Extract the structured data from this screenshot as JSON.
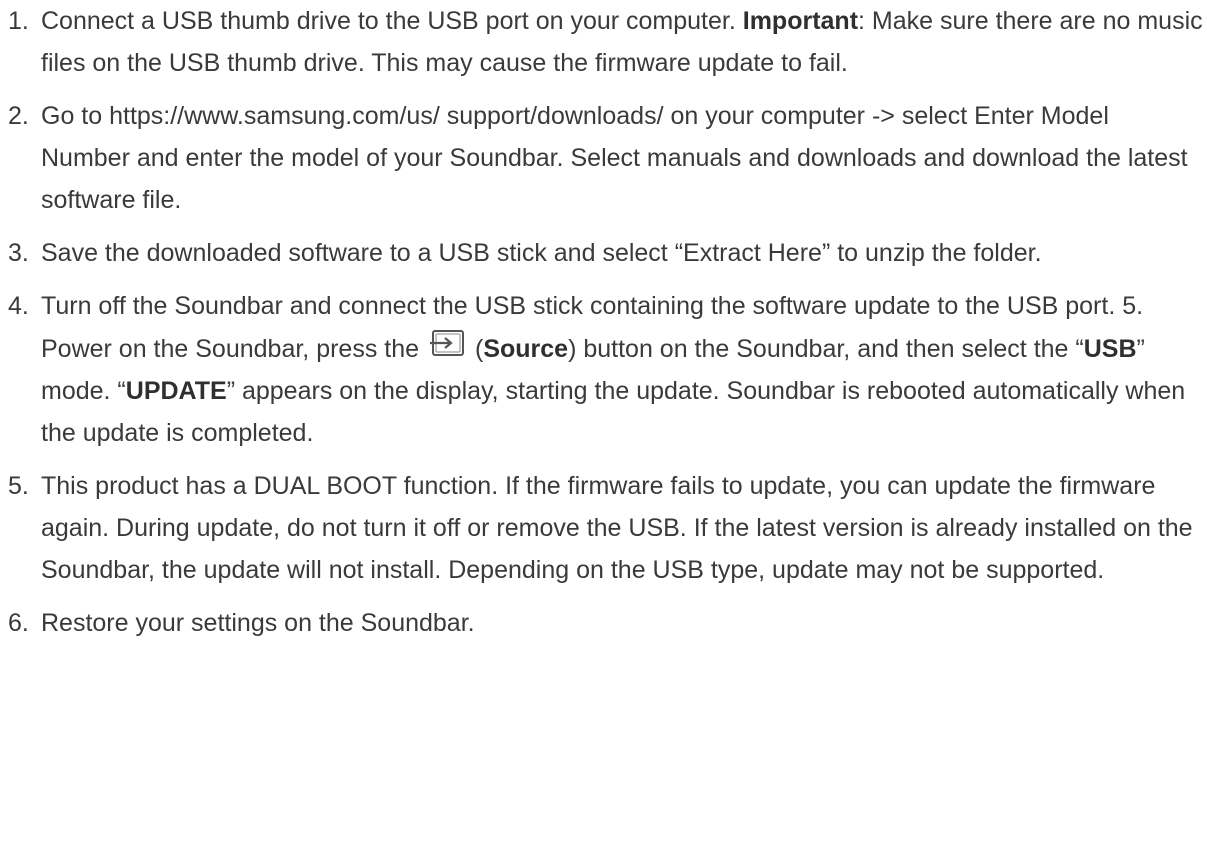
{
  "steps": [
    {
      "num": "1.",
      "t1": "Connect a USB thumb drive to the USB port on your computer. ",
      "b1": "Important",
      "t2": ": Make sure there are no music files on the USB thumb drive. This may cause the firmware update to fail."
    },
    {
      "num": "2.",
      "t1": "Go to https://www.samsung.com/us/ support/downloads/ on your computer -> select Enter Model Number and enter the model of your Soundbar. Select manuals and downloads and download the latest software file."
    },
    {
      "num": "3.",
      "t1": "Save the downloaded software to a USB stick and select “Extract Here” to unzip the folder."
    },
    {
      "num": "4.",
      "t1": "Turn off the Soundbar and connect the USB stick containing the software update to the USB port. 5. Power on the Soundbar, press the ",
      "icon": "source-input-icon",
      "t2": "(",
      "b1": "Source",
      "t3": ") button on the Soundbar, and then select the “",
      "b2": "USB",
      "t4": "” mode. “",
      "b3": "UPDATE",
      "t5": "” appears on the display, starting the update. Soundbar is rebooted automatically when the update is completed."
    },
    {
      "num": "5.",
      "t1": "This product has a DUAL BOOT function. If the firmware fails to update, you can update the firmware again. During update, do not turn it off or remove the USB. If the latest version is already installed on the Soundbar, the update will not install. Depending on the USB type, update may not be supported."
    },
    {
      "num": "6.",
      "t1": "Restore your settings on the Soundbar."
    }
  ]
}
